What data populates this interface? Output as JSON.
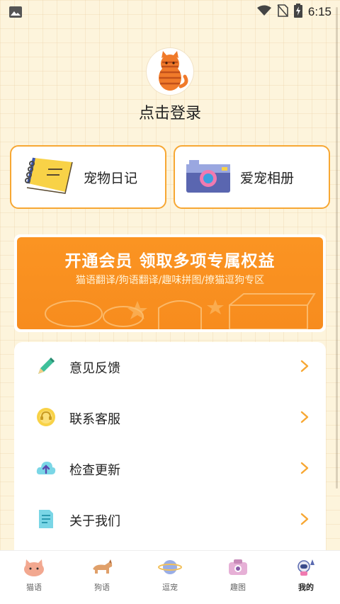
{
  "status_bar": {
    "time": "6:15"
  },
  "profile": {
    "login_text": "点击登录"
  },
  "quick_cards": [
    {
      "label": "宠物日记",
      "icon": "notebook-icon"
    },
    {
      "label": "爱宠相册",
      "icon": "camera-icon"
    }
  ],
  "banner": {
    "title": "开通会员 领取多项专属权益",
    "subtitle": "猫语翻译/狗语翻译/趣味拼图/撩猫逗狗专区"
  },
  "menu": [
    {
      "label": "意见反馈",
      "icon": "pencil-icon"
    },
    {
      "label": "联系客服",
      "icon": "customer-service-icon"
    },
    {
      "label": "检查更新",
      "icon": "cloud-upload-icon"
    },
    {
      "label": "关于我们",
      "icon": "document-icon"
    }
  ],
  "tabs": [
    {
      "label": "猫语",
      "icon": "cat-icon",
      "active": false
    },
    {
      "label": "狗语",
      "icon": "dog-icon",
      "active": false
    },
    {
      "label": "逗宠",
      "icon": "planet-icon",
      "active": false
    },
    {
      "label": "趣图",
      "icon": "camera-icon",
      "active": false
    },
    {
      "label": "我的",
      "icon": "astronaut-icon",
      "active": true
    }
  ],
  "colors": {
    "accent": "#f7a733",
    "banner": "#fb9422",
    "background": "#fdf4dc"
  }
}
